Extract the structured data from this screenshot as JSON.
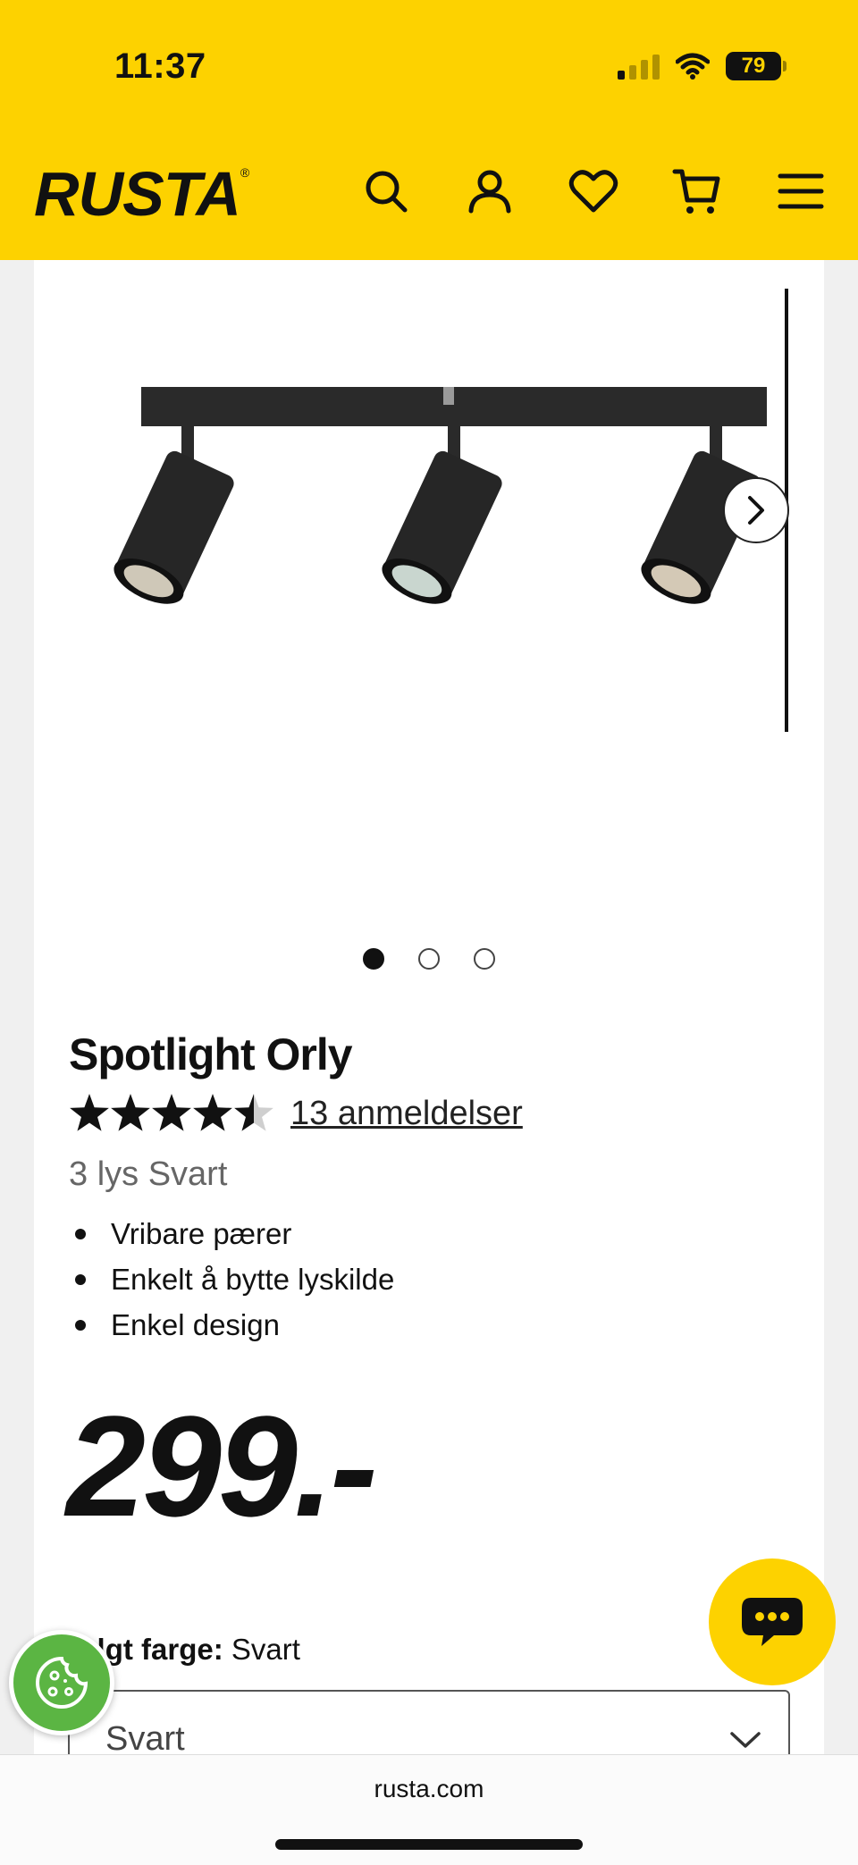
{
  "status_bar": {
    "time": "11:37",
    "battery": "79"
  },
  "header": {
    "logo": "RUSTA",
    "icons": [
      "search-icon",
      "account-icon",
      "heart-icon",
      "cart-icon",
      "menu-icon"
    ]
  },
  "product": {
    "title": "Spotlight Orly",
    "rating": 4.5,
    "rating_max": 5,
    "reviews_text": "13 anmeldelser",
    "variant": "3 lys Svart",
    "features": [
      "Vribare pærer",
      "Enkelt å bytte lyskilde",
      "Enkel design"
    ],
    "price": "299.-",
    "color_label": "Valgt farge:",
    "color_value": "Svart",
    "color_select_value": "Svart"
  },
  "gallery": {
    "images": 3,
    "active_index": 0
  },
  "browser": {
    "url": "rusta.com"
  },
  "colors": {
    "brand_yellow": "#fdd200",
    "cookie_green": "#5bb543",
    "text": "#111111"
  }
}
